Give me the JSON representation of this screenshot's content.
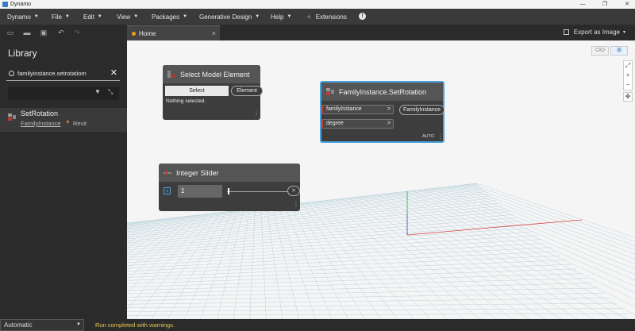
{
  "window": {
    "title": "Dynamo",
    "minimize": "—",
    "restore": "❐",
    "close": "✕"
  },
  "menu": {
    "items": [
      {
        "label": "Dynamo"
      },
      {
        "label": "File"
      },
      {
        "label": "Edit"
      },
      {
        "label": "View"
      },
      {
        "label": "Packages"
      },
      {
        "label": "Generative Design"
      },
      {
        "label": "Help"
      }
    ],
    "extensions_label": "Extensions",
    "info_glyph": "!"
  },
  "tab": {
    "label": "Home",
    "close": "×"
  },
  "export": {
    "label": "Export as Image",
    "caret": "▾"
  },
  "library": {
    "title": "Library",
    "search_value": "familyinstance.setrotatiom",
    "clear_glyph": "✕",
    "result": {
      "name": "SetRotation",
      "category": "FamilyInstance",
      "package": "Revit"
    }
  },
  "nodes": {
    "select_model": {
      "title": "Select Model Element",
      "button_label": "Select",
      "output_label": "Element",
      "status_text": "Nothing selected."
    },
    "set_rotation": {
      "title": "FamilyInstance.SetRotation",
      "inputs": [
        {
          "label": "familyInstance"
        },
        {
          "label": "degree"
        }
      ],
      "output_label": "FamilyInstance",
      "lacing": "AUTO"
    },
    "integer_slider": {
      "title": "Integer Slider",
      "value": "1",
      "expand_glyph": "+",
      "output_glyph": ">"
    }
  },
  "status": {
    "run_mode": "Automatic",
    "message": "Run completed with warnings."
  },
  "colors": {
    "accent_blue": "#4aa3df",
    "run_warning": "#e8c84a",
    "port_error": "#c0392b"
  }
}
